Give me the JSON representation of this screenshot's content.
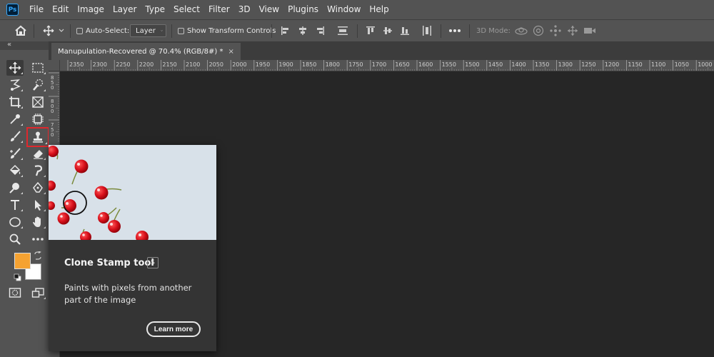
{
  "app": {
    "logo_text": "Ps"
  },
  "menu": [
    "File",
    "Edit",
    "Image",
    "Layer",
    "Type",
    "Select",
    "Filter",
    "3D",
    "View",
    "Plugins",
    "Window",
    "Help"
  ],
  "options_bar": {
    "auto_select_label": "Auto-Select:",
    "auto_select_checked": false,
    "layer_dropdown_value": "Layer",
    "show_transform_label": "Show Transform Controls",
    "show_transform_checked": false,
    "three_d_mode_label": "3D Mode:"
  },
  "toolbar": {
    "collapse_glyph": "«",
    "active_tool": "move-tool",
    "highlighted_tool": "clone-stamp-tool",
    "foreground_color": "#f5a231",
    "background_color": "#ffffff"
  },
  "document": {
    "tab_title": "Manupulation-Recovered @ 70.4% (RGB/8#) *",
    "close_glyph": "×"
  },
  "ruler": {
    "horizontal_ticks": [
      "2350",
      "2300",
      "2250",
      "2200",
      "2150",
      "2100",
      "2050",
      "2000",
      "1950",
      "1900",
      "1850",
      "1800",
      "1750",
      "1700",
      "1650",
      "1600",
      "1550",
      "1500",
      "1450",
      "1400",
      "1350",
      "1300",
      "1250",
      "1200",
      "1150",
      "1100",
      "1050",
      "1000"
    ],
    "vertical_ticks": [
      "850",
      "800",
      "750"
    ]
  },
  "tooltip": {
    "title": "Clone Stamp tool",
    "shortcut": "S",
    "description": "Paints with pixels from another part of the image",
    "learn_more": "Learn more"
  }
}
